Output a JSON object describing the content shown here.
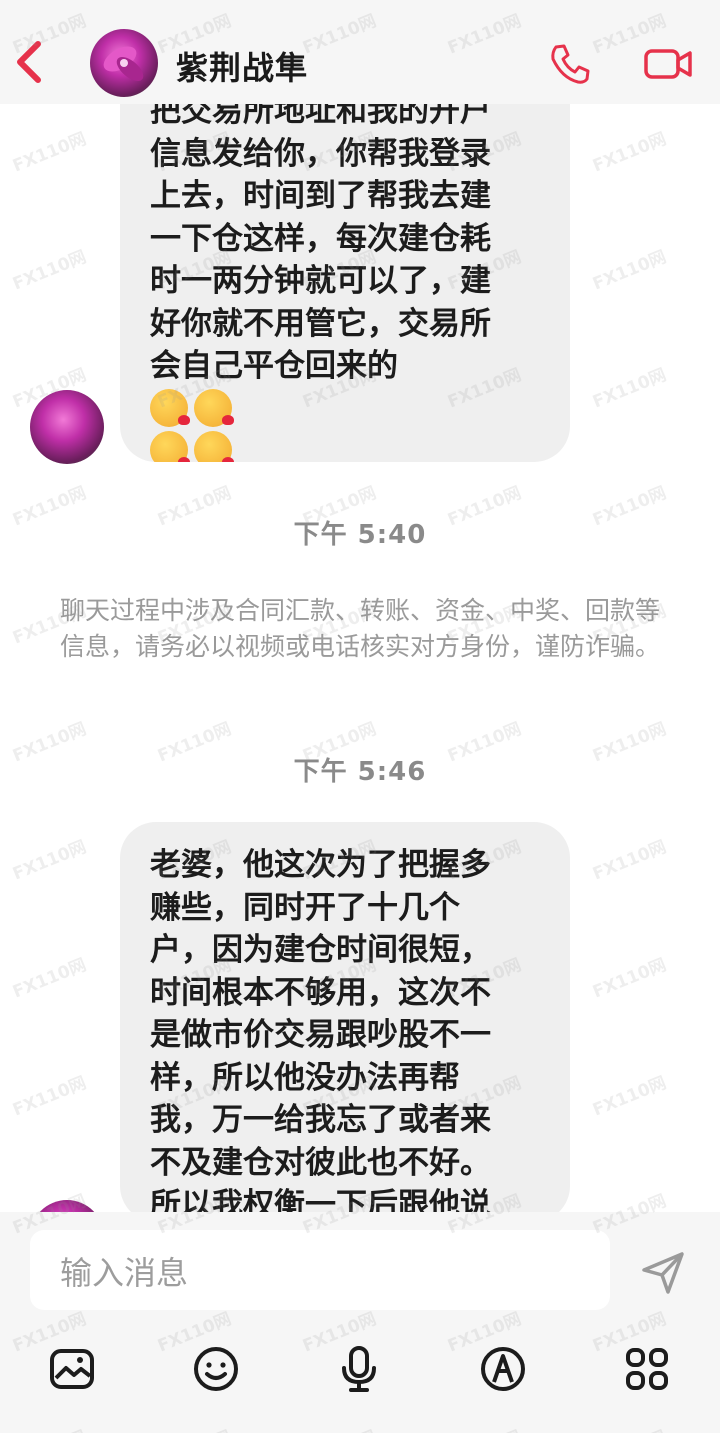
{
  "header": {
    "title": "紫荆战隼",
    "icons": {
      "back": "back-chevron-icon",
      "call": "phone-icon",
      "video": "video-camera-icon"
    },
    "accent_color": "#e6324b"
  },
  "messages": [
    {
      "text": "把交易所地址和我的开户\n信息发给你，你帮我登录\n上去，时间到了帮我去建\n一下仓这样，每次建仓耗\n时一两分钟就可以了，建\n好你就不用管它，交易所\n会自己平仓回来的",
      "emojis": [
        "kissing-face-icon",
        "kissing-face-icon",
        "kissing-face-icon",
        "kissing-face-icon"
      ]
    },
    {
      "text": "老婆，他这次为了把握多\n赚些，同时开了十几个\n户，因为建仓时间很短，\n时间根本不够用，这次不\n是做市价交易跟吵股不一\n样，所以他没办法再帮\n我，万一给我忘了或者来\n不及建仓对彼此也不好。\n所以我权衡一下后跟他说"
    }
  ],
  "timestamps": [
    "下午 5:40",
    "下午 5:46"
  ],
  "notice": "聊天过程中涉及合同汇款、转账、资金、中奖、回款等信息，请务必以视频或电话核实对方身份，谨防诈骗。",
  "input": {
    "placeholder": "输入消息"
  },
  "toolbar": [
    "photo-icon",
    "emoji-icon",
    "microphone-icon",
    "draw-icon",
    "more-apps-icon"
  ],
  "watermark": "FX110网"
}
